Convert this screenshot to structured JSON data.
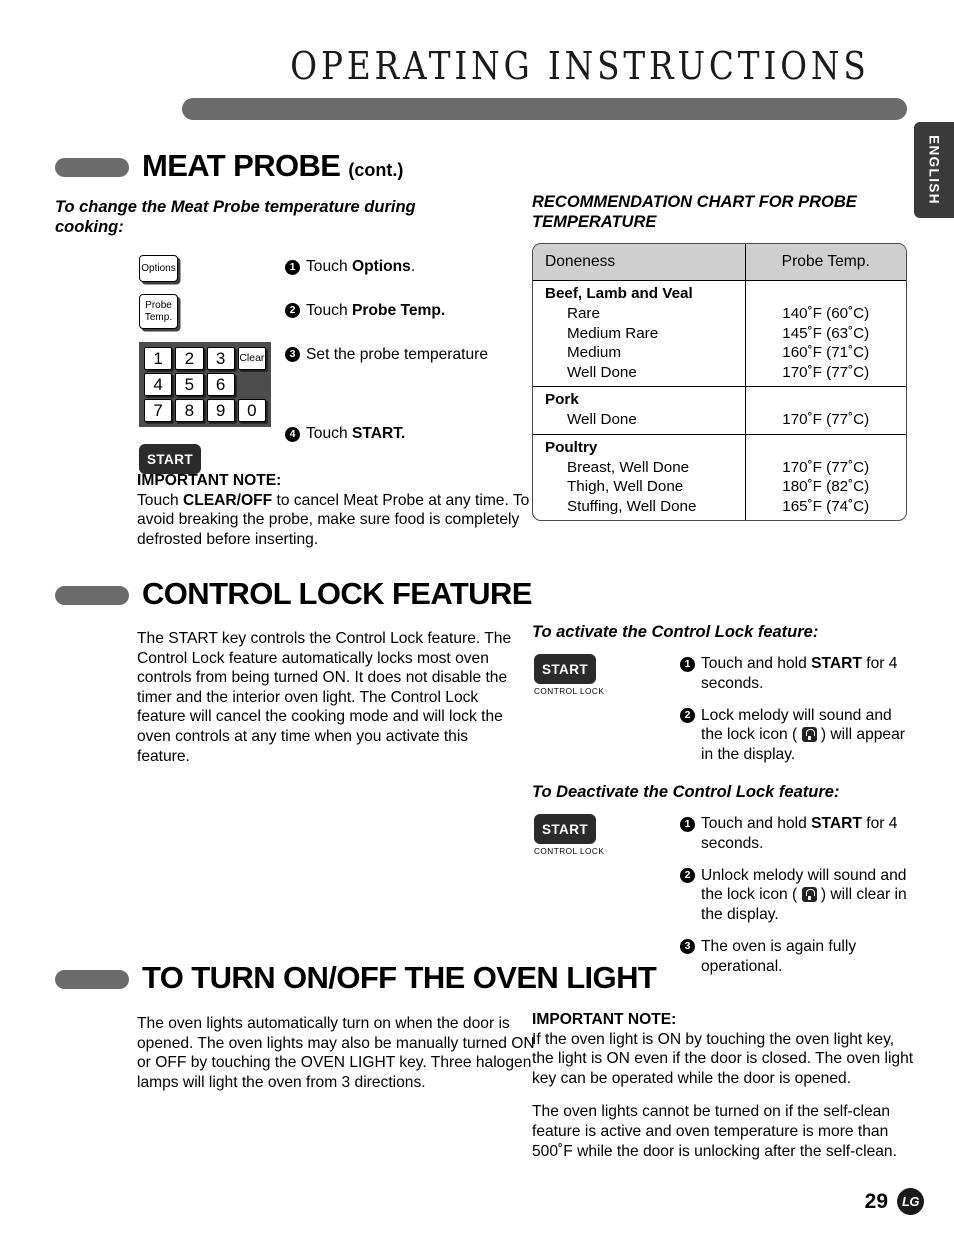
{
  "header": {
    "title": "OPERATING INSTRUCTIONS",
    "language_tab": "ENGLISH"
  },
  "meat_probe": {
    "title": "MEAT PROBE",
    "title_cont": "(cont.)",
    "subhead": "To change the Meat Probe temperature during cooking:",
    "keys": {
      "options": "Options",
      "probe_temp_line1": "Probe",
      "probe_temp_line2": "Temp.",
      "clear": "Clear",
      "start": "START",
      "digits": [
        "1",
        "2",
        "3",
        "4",
        "5",
        "6",
        "7",
        "8",
        "9",
        "0"
      ]
    },
    "steps": [
      {
        "num": "1",
        "text_before": "Touch ",
        "bold": "Options",
        "text_after": "."
      },
      {
        "num": "2",
        "text_before": "Touch ",
        "bold": "Probe Temp.",
        "text_after": ""
      },
      {
        "num": "3",
        "text_before": "Set the probe temperature",
        "bold": "",
        "text_after": ""
      },
      {
        "num": "4",
        "text_before": "Touch ",
        "bold": "START.",
        "text_after": ""
      }
    ],
    "important_note_heading": "IMPORTANT NOTE:",
    "important_note_before": "Touch ",
    "important_note_bold": "CLEAR/OFF",
    "important_note_after": " to cancel Meat Probe at any time. To avoid breaking the probe, make sure food is completely defrosted before inserting."
  },
  "probe_chart": {
    "title": "RECOMMENDATION CHART FOR PROBE TEMPERATURE",
    "columns": [
      "Doneness",
      "Probe Temp."
    ],
    "groups": [
      {
        "name": "Beef, Lamb and Veal",
        "rows": [
          {
            "item": "Rare",
            "temp": "140˚F (60˚C)"
          },
          {
            "item": "Medium Rare",
            "temp": "145˚F (63˚C)"
          },
          {
            "item": "Medium",
            "temp": "160˚F (71˚C)"
          },
          {
            "item": "Well Done",
            "temp": "170˚F (77˚C)"
          }
        ]
      },
      {
        "name": "Pork",
        "rows": [
          {
            "item": "Well Done",
            "temp": "170˚F (77˚C)"
          }
        ]
      },
      {
        "name": "Poultry",
        "rows": [
          {
            "item": "Breast, Well Done",
            "temp": "170˚F (77˚C)"
          },
          {
            "item": "Thigh, Well Done",
            "temp": "180˚F (82˚C)"
          },
          {
            "item": "Stuffing, Well Done",
            "temp": "165˚F (74˚C)"
          }
        ]
      }
    ]
  },
  "control_lock": {
    "title": "CONTROL LOCK FEATURE",
    "body": "The START key controls the Control Lock feature. The Control Lock feature automatically locks most oven controls from being turned ON. It does not disable the timer and the interior oven light. The Control Lock feature will cancel the cooking mode and will lock the oven controls at any time when you activate this feature.",
    "activate": {
      "subhead": "To activate the Control Lock feature:",
      "start_label": "START",
      "start_caption": "CONTROL LOCK",
      "step1_before": "Touch and hold ",
      "step1_bold": "START",
      "step1_after": " for 4 seconds.",
      "step2_before": "Lock melody will sound and the lock icon ( ",
      "step2_after": " ) will appear in the display."
    },
    "deactivate": {
      "subhead": "To Deactivate the Control Lock feature:",
      "start_label": "START",
      "start_caption": "CONTROL LOCK",
      "step1_before": "Touch and hold ",
      "step1_bold": "START",
      "step1_after": " for 4 seconds.",
      "step2_before": "Unlock melody will sound and the lock icon ( ",
      "step2_after": " ) will clear in the display.",
      "step3": "The oven is again fully operational."
    }
  },
  "oven_light": {
    "title": "TO TURN ON/OFF THE OVEN LIGHT",
    "body": "The oven lights automatically turn on when the door is opened. The oven lights may also be manually turned ON or OFF by touching the OVEN LIGHT key. Three halogen lamps will light the oven from 3 directions.",
    "important_note_heading": "IMPORTANT NOTE:",
    "important_note_p1": "If the oven light is ON by touching the oven light key, the light is ON even if the door is closed. The oven light key can be operated while the door is opened.",
    "important_note_p2": "The oven lights cannot be turned on if the self-clean feature is active and oven temperature is more than 500˚F while the door is unlocking after the self-clean."
  },
  "footer": {
    "page_number": "29",
    "logo": "LG"
  }
}
